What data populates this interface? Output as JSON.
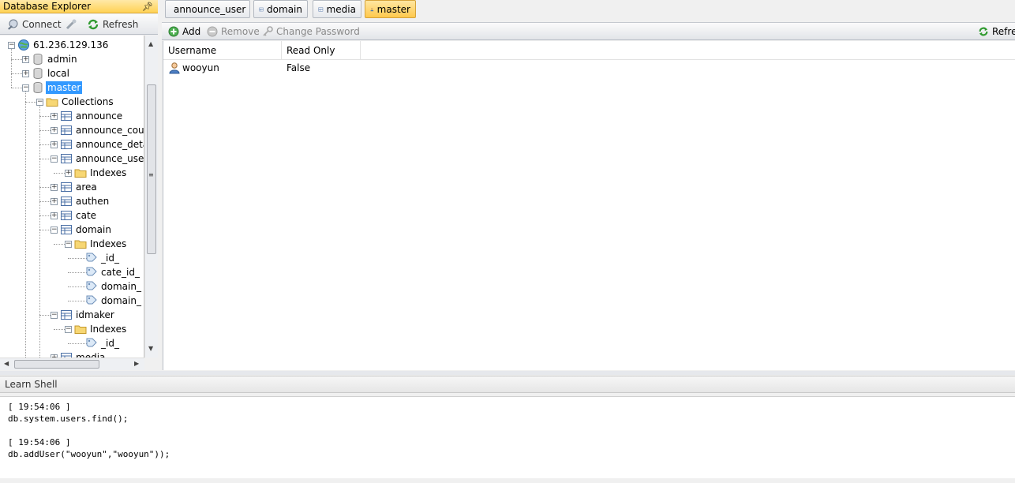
{
  "explorer": {
    "title": "Database Explorer",
    "pin_icon": "pin-icon",
    "connect_label": "Connect",
    "refresh_label": "Refresh"
  },
  "tree": {
    "server": "61.236.129.136",
    "dbs": [
      "admin",
      "local",
      "master"
    ],
    "collections_label": "Collections",
    "collections": [
      "announce",
      "announce_cour",
      "announce_deta",
      "announce_user",
      "area",
      "authen",
      "cate",
      "domain",
      "idmaker",
      "media"
    ],
    "indexes_label": "Indexes",
    "domain_indexes": [
      "_id_",
      "cate_id_",
      "domain_",
      "domain_"
    ],
    "idmaker_indexes": [
      "_id_"
    ]
  },
  "tabs": [
    {
      "label": "announce_user",
      "icon": "table-icon"
    },
    {
      "label": "domain",
      "icon": "table-icon"
    },
    {
      "label": "media",
      "icon": "table-icon"
    },
    {
      "label": "master",
      "icon": "user-icon",
      "active": true
    }
  ],
  "toolbar": {
    "add": "Add",
    "remove": "Remove",
    "change_password": "Change Password",
    "refresh": "Refres"
  },
  "grid": {
    "columns": [
      "Username",
      "Read Only"
    ],
    "rows": [
      {
        "username": "wooyun",
        "read_only": "False"
      }
    ]
  },
  "shell": {
    "title": "Learn Shell",
    "lines": [
      "[ 19:54:06 ]",
      "db.system.users.find();",
      "",
      "[ 19:54:06 ]",
      "db.addUser(\"wooyun\",\"wooyun\"));"
    ]
  },
  "colors": {
    "accent": "#ffd254",
    "selection": "#3399ff"
  }
}
